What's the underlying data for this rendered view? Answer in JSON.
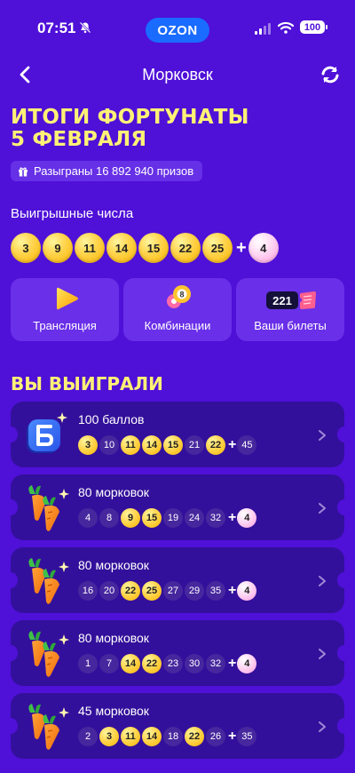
{
  "status": {
    "time": "07:51",
    "brand": "OZON",
    "battery": "100"
  },
  "nav": {
    "title": "Морковск"
  },
  "headline": {
    "line1": "ИТОГИ ФОРТУНАТЫ",
    "line2": "5 ФЕВРАЛЯ"
  },
  "prizes": "Разыграны 16 892 940 призов",
  "winning": {
    "label": "Выигрышные числа",
    "numbers": [
      "3",
      "9",
      "11",
      "14",
      "15",
      "22",
      "25"
    ],
    "bonus": "4"
  },
  "actions": [
    {
      "label": "Трансляция"
    },
    {
      "label": "Комбинации",
      "badge": "8"
    },
    {
      "label": "Ваши билеты",
      "count": "221"
    }
  ],
  "won_title": "ВЫ ВЫИГРАЛИ",
  "tickets": [
    {
      "title": "100 баллов",
      "icon": "ozon-points-icon",
      "numbers": [
        [
          "3",
          true
        ],
        [
          "10",
          false
        ],
        [
          "11",
          true
        ],
        [
          "14",
          true
        ],
        [
          "15",
          true
        ],
        [
          "21",
          false
        ],
        [
          "22",
          true
        ]
      ],
      "bonus": [
        "45",
        false
      ]
    },
    {
      "title": "80 морковок",
      "icon": "carrot-icon",
      "numbers": [
        [
          "4",
          false
        ],
        [
          "8",
          false
        ],
        [
          "9",
          true
        ],
        [
          "15",
          true
        ],
        [
          "19",
          false
        ],
        [
          "24",
          false
        ],
        [
          "32",
          false
        ]
      ],
      "bonus": [
        "4",
        true
      ]
    },
    {
      "title": "80 морковок",
      "icon": "carrot-icon",
      "numbers": [
        [
          "16",
          false
        ],
        [
          "20",
          false
        ],
        [
          "22",
          true
        ],
        [
          "25",
          true
        ],
        [
          "27",
          false
        ],
        [
          "29",
          false
        ],
        [
          "35",
          false
        ]
      ],
      "bonus": [
        "4",
        true
      ]
    },
    {
      "title": "80 морковок",
      "icon": "carrot-icon",
      "numbers": [
        [
          "1",
          false
        ],
        [
          "7",
          false
        ],
        [
          "14",
          true
        ],
        [
          "22",
          true
        ],
        [
          "23",
          false
        ],
        [
          "30",
          false
        ],
        [
          "32",
          false
        ]
      ],
      "bonus": [
        "4",
        true
      ]
    },
    {
      "title": "45 морковок",
      "icon": "carrot-icon",
      "numbers": [
        [
          "2",
          false
        ],
        [
          "3",
          true
        ],
        [
          "11",
          true
        ],
        [
          "14",
          true
        ],
        [
          "18",
          false
        ],
        [
          "22",
          true
        ],
        [
          "26",
          false
        ]
      ],
      "bonus": [
        "35",
        false
      ]
    }
  ],
  "colors": {
    "background": "#4f10d8",
    "card": "#33109b",
    "accent_yellow": "#fff176",
    "hit_ball": "#ffd54f",
    "bonus_ball": "#ffb3ec"
  }
}
